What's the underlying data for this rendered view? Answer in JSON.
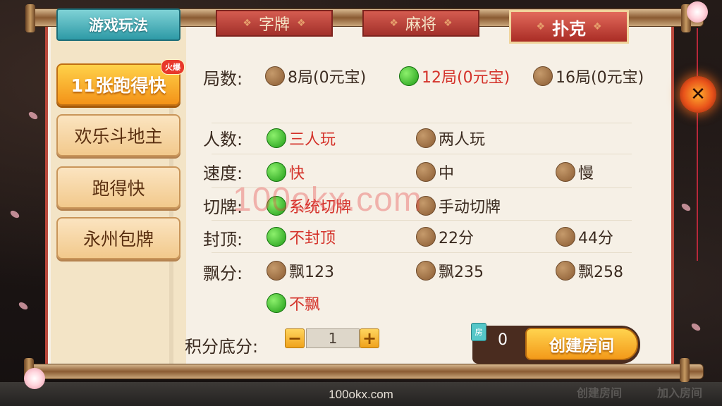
{
  "category_tabs": {
    "play_label": "游戏玩法",
    "zipai": "字牌",
    "majiang": "麻将",
    "puke": "扑克",
    "active": "扑克"
  },
  "sidebar": {
    "games": [
      {
        "label": "11张跑得快",
        "selected": true,
        "badge": "火爆"
      },
      {
        "label": "欢乐斗地主",
        "selected": false
      },
      {
        "label": "跑得快",
        "selected": false
      },
      {
        "label": "永州包牌",
        "selected": false
      }
    ]
  },
  "rules": {
    "rounds": {
      "label": "局数:",
      "options": [
        {
          "text": "8局(0元宝)",
          "selected": false
        },
        {
          "text": "12局(0元宝)",
          "selected": true
        },
        {
          "text": "16局(0元宝)",
          "selected": false
        }
      ]
    },
    "players": {
      "label": "人数:",
      "options": [
        {
          "text": "三人玩",
          "selected": true
        },
        {
          "text": "两人玩",
          "selected": false
        }
      ]
    },
    "speed": {
      "label": "速度:",
      "options": [
        {
          "text": "快",
          "selected": true
        },
        {
          "text": "中",
          "selected": false
        },
        {
          "text": "慢",
          "selected": false
        }
      ]
    },
    "cut": {
      "label": "切牌:",
      "options": [
        {
          "text": "系统切牌",
          "selected": true
        },
        {
          "text": "手动切牌",
          "selected": false
        }
      ]
    },
    "cap": {
      "label": "封顶:",
      "options": [
        {
          "text": "不封顶",
          "selected": true
        },
        {
          "text": "22分",
          "selected": false
        },
        {
          "text": "44分",
          "selected": false
        }
      ]
    },
    "float": {
      "label": "飘分:",
      "options": [
        {
          "text": "飘123",
          "selected": false
        },
        {
          "text": "飘235",
          "selected": false
        },
        {
          "text": "飘258",
          "selected": false
        },
        {
          "text": "不飘",
          "selected": true
        }
      ]
    }
  },
  "base_score": {
    "label": "积分底分:",
    "minus": "−",
    "value": "1",
    "plus": "+"
  },
  "create_room": {
    "icon_label": "房",
    "count": "0",
    "button_label": "创建房间"
  },
  "close_label": "✕",
  "watermark": "100okx.com",
  "footer_text": "100okx.com",
  "background_bar": {
    "create_room": "创建房间",
    "join_room": "加入房间"
  },
  "colors": {
    "selected_text": "#d4322a",
    "panel": "#f6f0e6",
    "accent_red": "#b9483b"
  }
}
